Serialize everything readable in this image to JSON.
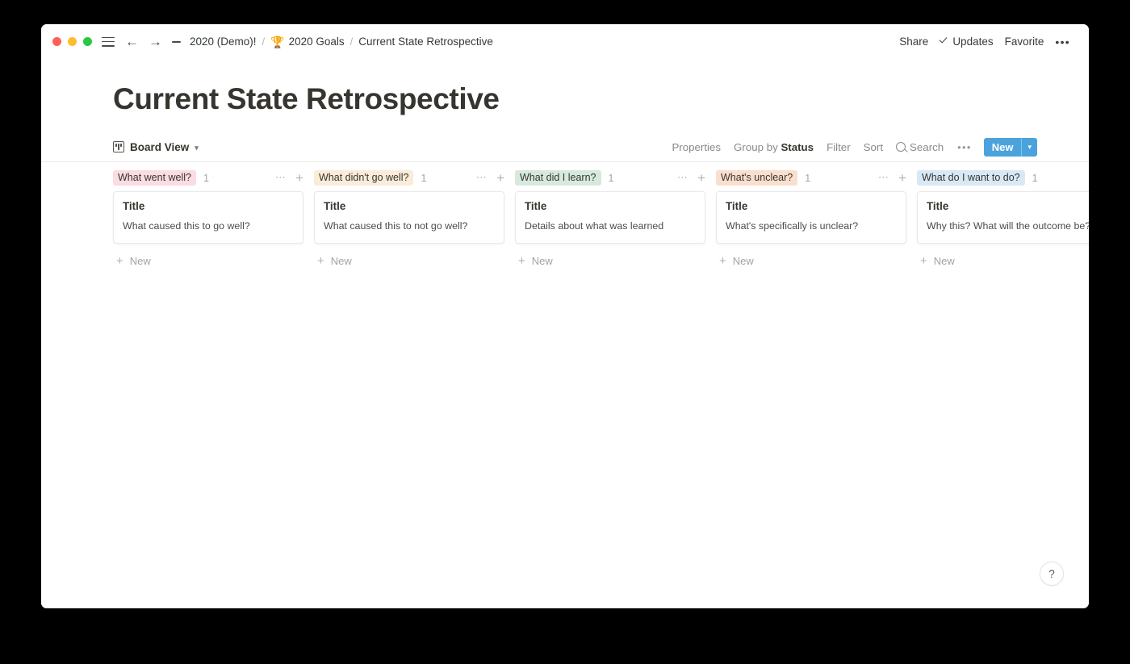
{
  "window": {
    "traffic_lights": [
      "close",
      "minimize",
      "zoom"
    ],
    "nav": {
      "menu_icon": "hamburger-icon",
      "back_icon": "arrow-left-icon",
      "forward_icon": "arrow-right-icon",
      "collapse_icon": "dash-icon"
    },
    "breadcrumb": [
      {
        "label": "2020 (Demo)!",
        "emoji": ""
      },
      {
        "label": "2020 Goals",
        "emoji": "🏆"
      },
      {
        "label": "Current State Retrospective",
        "emoji": ""
      }
    ],
    "breadcrumb_separator": "/",
    "actions": {
      "share": "Share",
      "updates": "Updates",
      "favorite": "Favorite",
      "more": "•••"
    }
  },
  "page": {
    "title": "Current State Retrospective"
  },
  "toolbar": {
    "view_name": "Board View",
    "view_icon": "board-view-icon",
    "view_chevron": "⌄",
    "properties": "Properties",
    "group_by_prefix": "Group by ",
    "group_by_value": "Status",
    "filter": "Filter",
    "sort": "Sort",
    "search": "Search",
    "more": "•••",
    "new_label": "New",
    "new_caret": "⌄",
    "new_color": "#4aa3dc"
  },
  "board": {
    "card_title_label": "Title",
    "new_label": "New",
    "columns": [
      {
        "name": "What went well?",
        "count": "1",
        "tag_bg": "#fadce2",
        "cards": [
          {
            "title": "Title",
            "subtitle": "What caused this to go well?"
          }
        ]
      },
      {
        "name": "What didn't go well?",
        "count": "1",
        "tag_bg": "#faecd9",
        "cards": [
          {
            "title": "Title",
            "subtitle": "What caused this to not go well?"
          }
        ]
      },
      {
        "name": "What did I learn?",
        "count": "1",
        "tag_bg": "#d7e9dd",
        "cards": [
          {
            "title": "Title",
            "subtitle": "Details about what was learned"
          }
        ]
      },
      {
        "name": "What's unclear?",
        "count": "1",
        "tag_bg": "#fadfce",
        "cards": [
          {
            "title": "Title",
            "subtitle": "What's specifically is unclear?"
          }
        ]
      },
      {
        "name": "What do I want to do?",
        "count": "1",
        "tag_bg": "#d9e8f5",
        "cards": [
          {
            "title": "Title",
            "subtitle": "Why this? What will the outcome be?"
          }
        ]
      }
    ]
  },
  "help": {
    "label": "?"
  }
}
